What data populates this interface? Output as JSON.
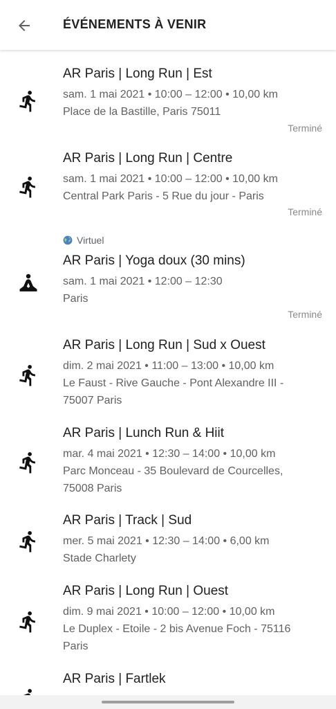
{
  "header": {
    "title": "ÉVÉNEMENTS À VENIR",
    "back_icon": "arrow-back-icon"
  },
  "events": [
    {
      "icon": "running-icon",
      "title": "AR Paris | Long Run | Est",
      "when": "sam. 1 mai 2021 • 10:00 – 12:00  • 10,00 km",
      "where1": "Place de la Bastille, Paris 75011",
      "status": "Terminé"
    },
    {
      "icon": "running-icon",
      "title": "AR Paris | Long Run | Centre",
      "when": "sam. 1 mai 2021 • 10:00 – 12:00  • 10,00 km",
      "where1": "Central Park Paris - 5 Rue du jour - Paris",
      "status": "Terminé"
    },
    {
      "badge": "Virtuel",
      "badge_icon": "globe-icon",
      "icon": "yoga-icon",
      "title": "AR Paris | Yoga doux (30 mins)",
      "when": "sam. 1 mai 2021 • 12:00 – 12:30",
      "where1": "Paris",
      "status": "Terminé"
    },
    {
      "icon": "running-icon",
      "title": "AR Paris | Long Run | Sud x Ouest",
      "when": "dim. 2 mai 2021 • 11:00 – 13:00  • 10,00 km",
      "where1": "Le Faust - Rive Gauche - Pont Alexandre III -",
      "where2": "75007 Paris"
    },
    {
      "icon": "running-icon",
      "title": "AR Paris | Lunch Run & Hiit",
      "when": "mar. 4 mai 2021 • 12:30 – 14:00  • 10,00 km",
      "where1": "Parc Monceau - 35 Boulevard de Courcelles,",
      "where2": "75008 Paris"
    },
    {
      "icon": "running-icon",
      "title": "AR Paris | Track | Sud",
      "when": "mer. 5 mai 2021 • 12:30 – 14:00  • 6,00 km",
      "where1": "Stade Charlety"
    },
    {
      "icon": "running-icon",
      "title": "AR Paris | Long Run | Ouest",
      "when": "dim. 9 mai 2021 • 10:00 – 12:00  • 10,00 km",
      "where1": "Le  Duplex - Etoile - 2 bis Avenue Foch - 75116",
      "where2": "Paris"
    },
    {
      "icon": "running-icon",
      "title": "AR Paris | Fartlek"
    }
  ]
}
